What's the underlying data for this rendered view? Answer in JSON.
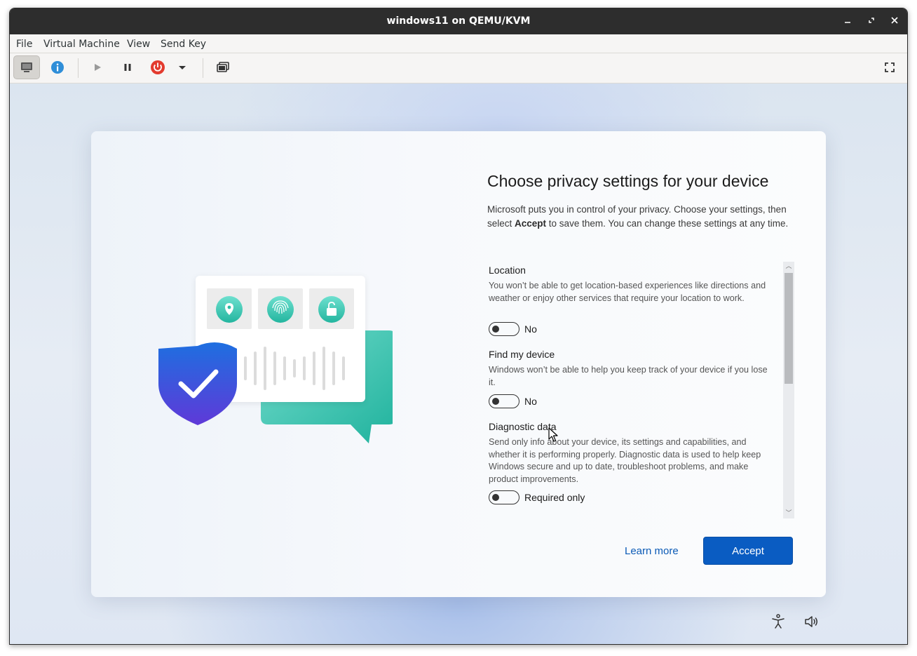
{
  "window": {
    "title": "windows11 on QEMU/KVM",
    "controls": {
      "minimize": "–",
      "restore": "⤢",
      "close": "✕"
    }
  },
  "menubar": {
    "items": [
      "File",
      "Virtual Machine",
      "View",
      "Send Key"
    ]
  },
  "toolbar": {
    "buttons": [
      "display-console",
      "details-info",
      "run",
      "pause",
      "shutdown",
      "shutdown-menu",
      "snapshots",
      "fullscreen"
    ],
    "colors": {
      "info": "#2f8ed8",
      "shutdown": "#e33b2e"
    }
  },
  "setup": {
    "heading": "Choose privacy settings for your device",
    "intro_before": "Microsoft puts you in control of your privacy. Choose your settings, then select ",
    "intro_bold": "Accept",
    "intro_after": " to save them. You can change these settings at any time.",
    "settings": [
      {
        "title": "Location",
        "description": "You won’t be able to get location-based experiences like directions and weather or enjoy other services that require your location to work.",
        "value": "No"
      },
      {
        "title": "Find my device",
        "description": "Windows won’t be able to help you keep track of your device if you lose it.",
        "value": "No"
      },
      {
        "title": "Diagnostic data",
        "description": "Send only info about your device, its settings and capabilities, and whether it is performing properly. Diagnostic data is used to help keep Windows secure and up to date, troubleshoot problems, and make product improvements.",
        "value": "Required only"
      }
    ],
    "learn_more": "Learn more",
    "accept": "Accept",
    "accent_color": "#0a5cc2"
  },
  "system_icons": [
    "accessibility-icon",
    "volume-icon"
  ]
}
